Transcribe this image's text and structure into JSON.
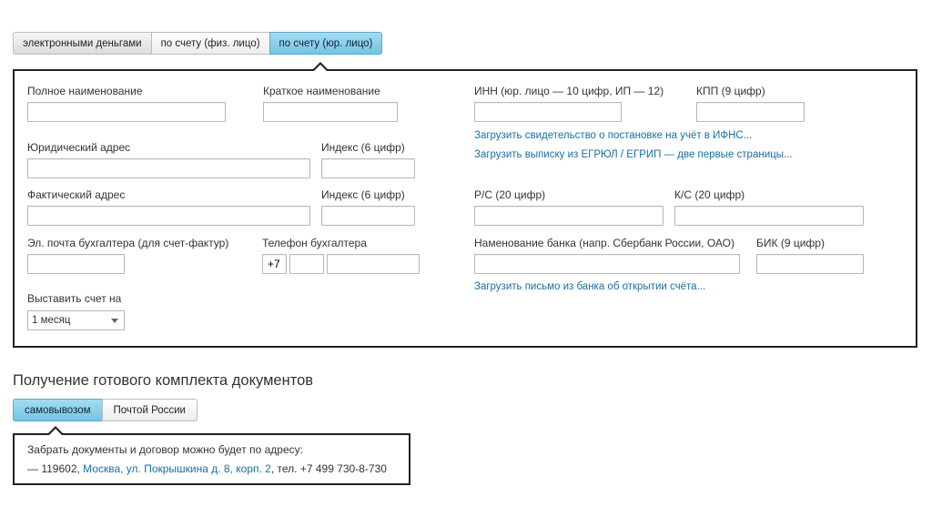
{
  "payment_tabs": [
    {
      "label": "электронными деньгами",
      "active": false
    },
    {
      "label": "по счету (физ. лицо)",
      "active": false
    },
    {
      "label": "по счету (юр. лицо)",
      "active": true
    }
  ],
  "form": {
    "full_name_label": "Полное наименование",
    "short_name_label": "Краткое наименование",
    "inn_label": "ИНН (юр. лицо — 10 цифр, ИП — 12)",
    "kpp_label": "КПП (9 цифр)",
    "upload_ifns_link": "Загрузить свидетельство о постановке на учёт в ИФНС...",
    "upload_egrul_link": "Загрузить выписку из ЕГРЮЛ / ЕГРИП — две первые страницы...",
    "legal_address_label": "Юридический адрес",
    "legal_index_label": "Индекс (6 цифр)",
    "actual_address_label": "Фактический адрес",
    "actual_index_label": "Индекс (6 цифр)",
    "rs_label": "Р/С (20 цифр)",
    "ks_label": "К/С (20 цифр)",
    "email_label": "Эл. почта бухгалтера (для счет-фактур)",
    "phone_label": "Телефон бухгалтера",
    "phone_prefix": "+7",
    "bank_name_label": "Наменование банка (напр. Сбербанк России, ОАО)",
    "bik_label": "БИК (9 цифр)",
    "upload_bank_letter_link": "Загрузить письмо из банка об открытии счёта...",
    "invoice_period_label": "Выставить счет на",
    "invoice_period_value": "1 месяц"
  },
  "delivery": {
    "title": "Получение готового комплекта документов",
    "tabs": [
      {
        "label": "самовывозом",
        "active": true
      },
      {
        "label": "Почтой России",
        "active": false
      }
    ],
    "pickup_text": "Забрать документы и договор можно будет по адресу:",
    "address_prefix": "— 119602, ",
    "address_link": "Москва, ул. Покрышкина д. 8, корп. 2",
    "address_suffix": ", тел. +7 499 730-8-730"
  },
  "colors": {
    "active_tab": "#74c3e4",
    "link": "#1a6f9e",
    "panel_border": "#222222"
  }
}
